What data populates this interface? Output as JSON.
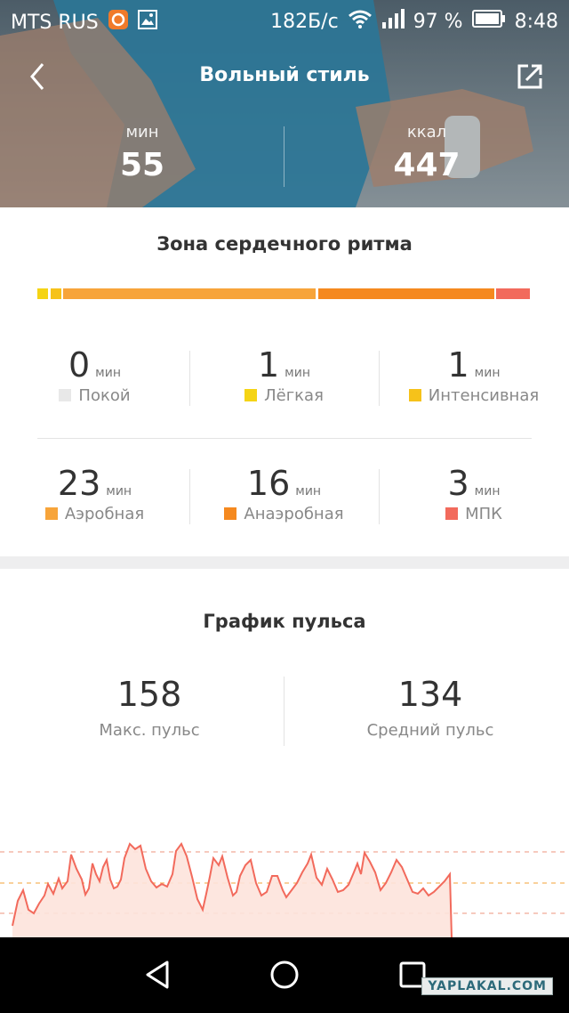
{
  "status_bar": {
    "carrier": "MTS RUS",
    "speed": "182Б/с",
    "battery": "97 %",
    "time": "8:48",
    "icons": [
      "app-notification-icon",
      "image-icon",
      "wifi-icon",
      "signal-icon",
      "battery-icon"
    ]
  },
  "header": {
    "title": "Вольный стиль",
    "back_icon": "chevron-left-icon",
    "share_icon": "share-icon"
  },
  "summary": {
    "duration": {
      "unit": "мин",
      "value": "55"
    },
    "calories": {
      "unit": "ккал",
      "value": "447"
    }
  },
  "heart_zones": {
    "title": "Зона сердечного ритма",
    "unit": "мин",
    "zones": [
      {
        "value": "0",
        "label": "Покой",
        "color": "#e8e8e8"
      },
      {
        "value": "1",
        "label": "Лёгкая",
        "color": "#f5d415"
      },
      {
        "value": "1",
        "label": "Интенсивная",
        "color": "#f6c21a"
      },
      {
        "value": "23",
        "label": "Аэробная",
        "color": "#f7a43a"
      },
      {
        "value": "16",
        "label": "Анаэробная",
        "color": "#f5891f"
      },
      {
        "value": "3",
        "label": "МПК",
        "color": "#f26a5c"
      }
    ]
  },
  "pulse": {
    "title": "График пульса",
    "max": {
      "value": "158",
      "label": "Макс. пульс"
    },
    "avg": {
      "value": "134",
      "label": "Средний пульс"
    },
    "line_color": "#f26a5c",
    "fill_color": "#fde3dc"
  },
  "nav": {
    "icons": [
      "back-triangle-icon",
      "home-circle-icon",
      "recents-square-icon"
    ]
  },
  "watermark": "YAPLAKAL.COM"
}
